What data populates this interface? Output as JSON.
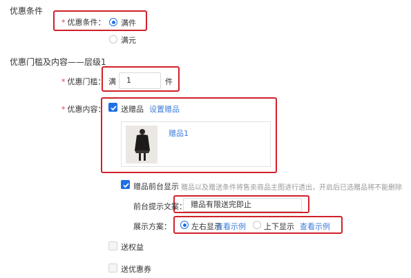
{
  "sections": {
    "promo_condition_title": "优惠条件",
    "threshold_title": "优惠门槛及内容——层级1"
  },
  "condition": {
    "label": "优惠条件：",
    "options": [
      "满件",
      "满元"
    ],
    "selected": "满件"
  },
  "threshold": {
    "label": "优惠门槛：",
    "prefix": "满",
    "value": "1",
    "suffix": "件"
  },
  "content": {
    "label": "优惠内容：",
    "send_gift_label": "送赠品",
    "set_gift_link": "设置赠品",
    "gift_name": "赠品1",
    "gift_display_label": "赠品前台显示",
    "gift_display_hint": "赠品以及赠送条件将售卖商品主图进行透出，开启后已选赠品将不能删除",
    "tip_text_label": "前台提示文案：",
    "tip_text_value": "赠品有限送完即止",
    "display_scheme_label": "展示方案：",
    "scheme_options": [
      "左右显示",
      "上下显示"
    ],
    "view_example_link": "查看示例",
    "send_rights_label": "送权益",
    "send_coupon_label": "送优惠券"
  },
  "colors": {
    "accent": "#1f6fe5",
    "highlight": "#d0202a",
    "link": "#3d7bd9"
  }
}
